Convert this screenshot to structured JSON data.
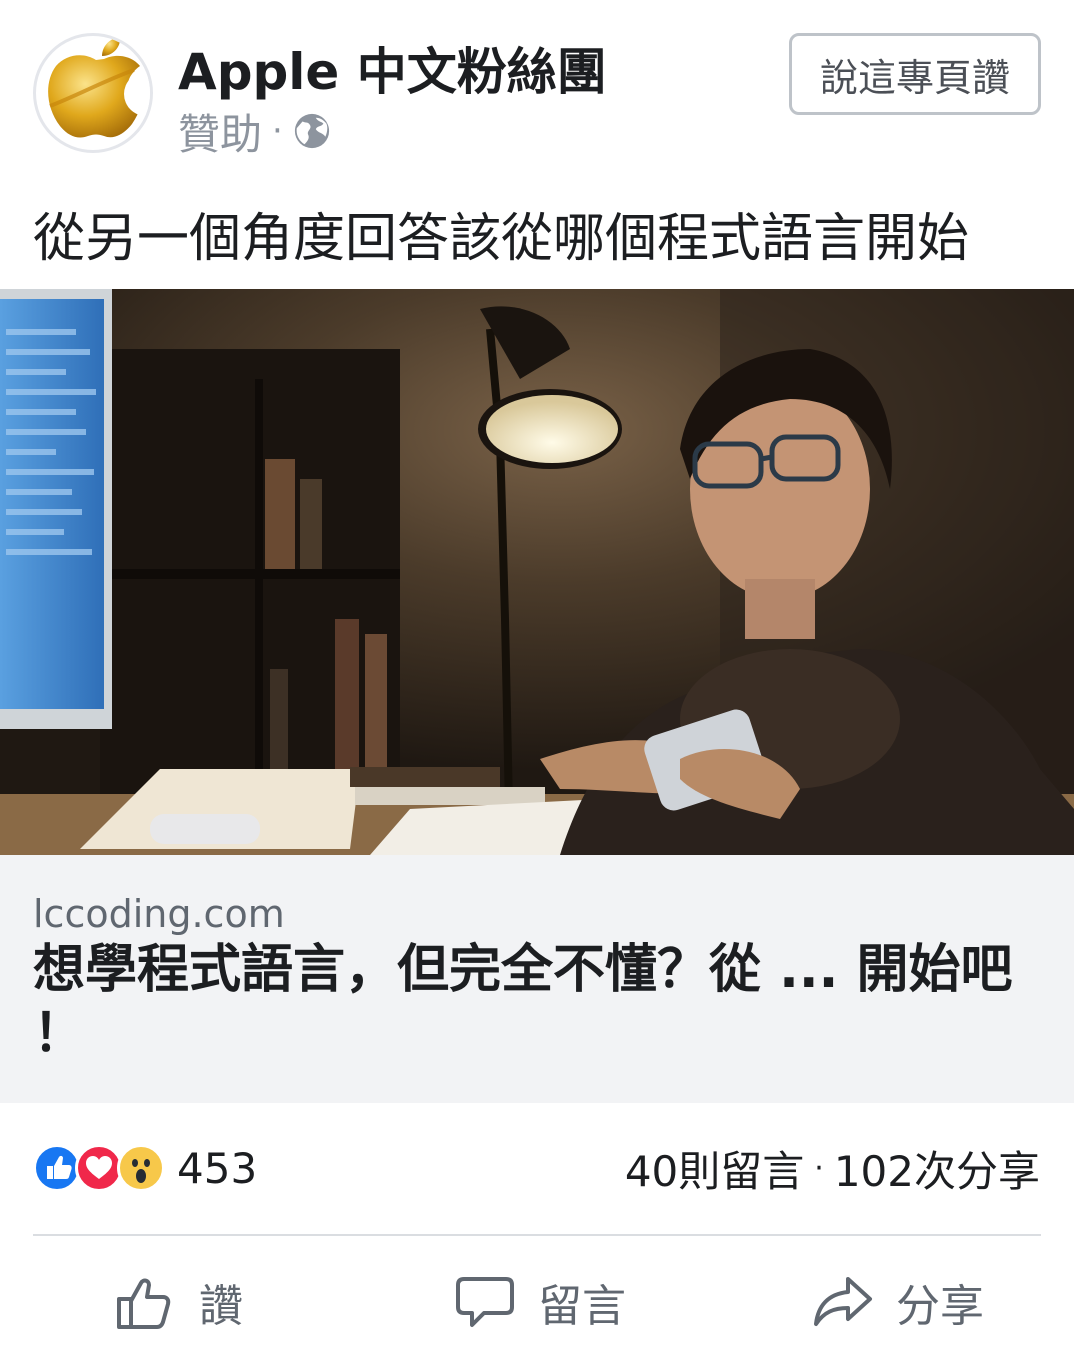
{
  "header": {
    "page_name": "Apple 中文粉絲團",
    "sponsored": "贊助",
    "separator": "·",
    "like_page_button": "說這專頁讚",
    "avatar_icon": "apple-gold-logo-icon",
    "privacy_icon": "globe-icon"
  },
  "post": {
    "text": "從另一個角度回答該從哪個程式語言開始"
  },
  "link_preview": {
    "domain": "lccoding.com",
    "title": "想學程式語言，但完全不懂？從 ... 開始吧 ！"
  },
  "engagement": {
    "reaction_icons": [
      "like-reaction-icon",
      "love-reaction-icon",
      "wow-reaction-icon"
    ],
    "reaction_count": "453",
    "comments": "40則留言",
    "separator": "·",
    "shares": "102次分享"
  },
  "actions": {
    "like": "讚",
    "comment": "留言",
    "share": "分享"
  },
  "colors": {
    "like_blue": "#1877f2",
    "love_red": "#f0284a",
    "wow_yellow": "#f7c84a",
    "link_box_bg": "#f2f3f5",
    "muted_text": "#606770"
  }
}
